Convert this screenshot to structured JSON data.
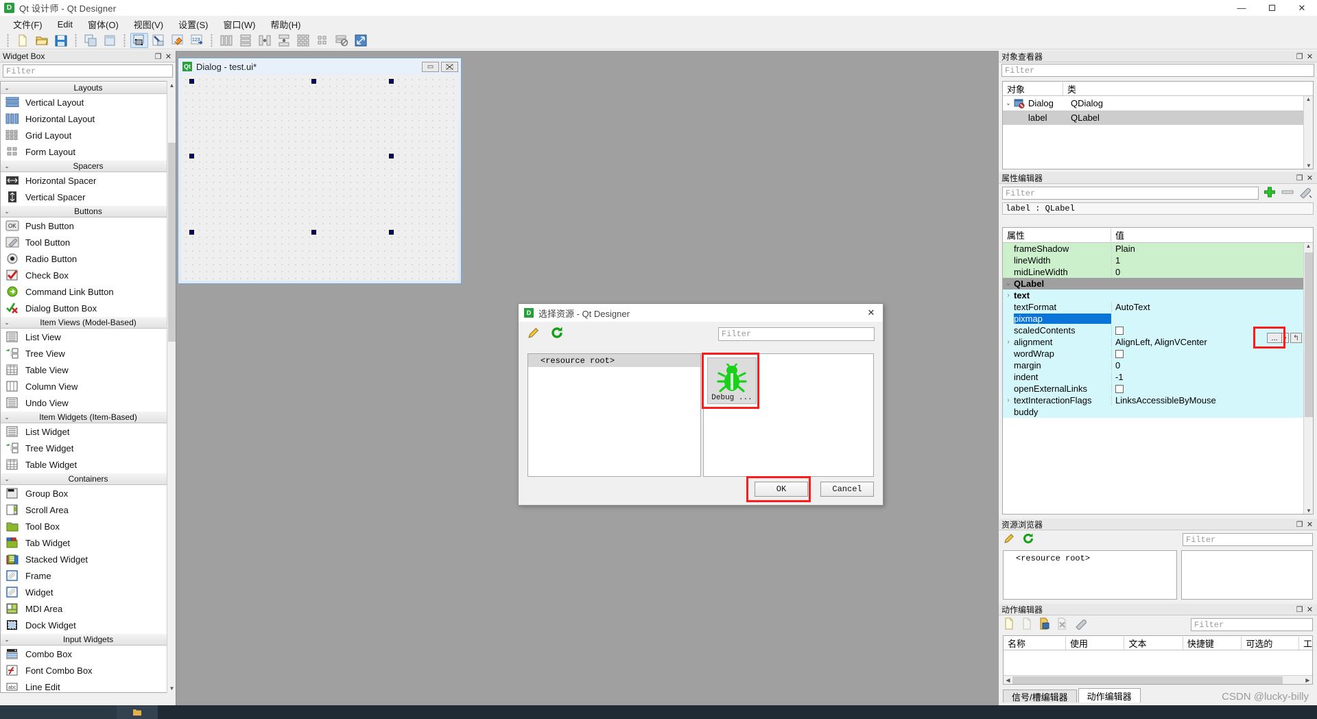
{
  "window": {
    "title": "Qt 设计师 - Qt Designer",
    "logo": "qt-logo",
    "minimize": "—",
    "maximize": "▢",
    "close": "✕"
  },
  "menubar": {
    "items": [
      {
        "label": "文件(F)"
      },
      {
        "label": "Edit"
      },
      {
        "label": "窗体(O)"
      },
      {
        "label": "视图(V)"
      },
      {
        "label": "设置(S)"
      },
      {
        "label": "窗口(W)"
      },
      {
        "label": "帮助(H)"
      }
    ]
  },
  "toolbar": {
    "groups": [
      [
        "new-file-icon",
        "open-folder-icon",
        "save-disk-icon"
      ],
      [
        "copy-windows-icon",
        "paste-window-icon"
      ],
      [
        "edit-widgets-icon",
        "edit-signals-slots-icon",
        "edit-buddies-icon",
        "edit-tab-order-icon"
      ],
      [
        "layout-horizontally-icon",
        "layout-vertically-icon",
        "layout-splitter-h-icon",
        "layout-splitter-v-icon",
        "layout-grid-icon",
        "layout-form-icon",
        "break-layout-icon",
        "adjust-size-icon"
      ]
    ]
  },
  "widget_box": {
    "title": "Widget Box",
    "undock": "❐",
    "close": "✕",
    "filter_placeholder": "Filter",
    "groups": [
      {
        "label": "Layouts",
        "items": [
          {
            "label": "Vertical Layout",
            "icon": "vertical-layout-icon"
          },
          {
            "label": "Horizontal Layout",
            "icon": "horizontal-layout-icon"
          },
          {
            "label": "Grid Layout",
            "icon": "grid-layout-icon"
          },
          {
            "label": "Form Layout",
            "icon": "form-layout-icon"
          }
        ]
      },
      {
        "label": "Spacers",
        "items": [
          {
            "label": "Horizontal Spacer",
            "icon": "horizontal-spacer-icon"
          },
          {
            "label": "Vertical Spacer",
            "icon": "vertical-spacer-icon"
          }
        ]
      },
      {
        "label": "Buttons",
        "items": [
          {
            "label": "Push Button",
            "icon": "push-button-icon"
          },
          {
            "label": "Tool Button",
            "icon": "tool-button-icon"
          },
          {
            "label": "Radio Button",
            "icon": "radio-button-icon"
          },
          {
            "label": "Check Box",
            "icon": "check-box-icon"
          },
          {
            "label": "Command Link Button",
            "icon": "command-link-button-icon"
          },
          {
            "label": "Dialog Button Box",
            "icon": "dialog-button-box-icon"
          }
        ]
      },
      {
        "label": "Item Views (Model-Based)",
        "items": [
          {
            "label": "List View",
            "icon": "list-view-icon"
          },
          {
            "label": "Tree View",
            "icon": "tree-view-icon"
          },
          {
            "label": "Table View",
            "icon": "table-view-icon"
          },
          {
            "label": "Column View",
            "icon": "column-view-icon"
          },
          {
            "label": "Undo View",
            "icon": "undo-view-icon"
          }
        ]
      },
      {
        "label": "Item Widgets (Item-Based)",
        "items": [
          {
            "label": "List Widget",
            "icon": "list-widget-icon"
          },
          {
            "label": "Tree Widget",
            "icon": "tree-widget-icon"
          },
          {
            "label": "Table Widget",
            "icon": "table-widget-icon"
          }
        ]
      },
      {
        "label": "Containers",
        "items": [
          {
            "label": "Group Box",
            "icon": "group-box-icon"
          },
          {
            "label": "Scroll Area",
            "icon": "scroll-area-icon"
          },
          {
            "label": "Tool Box",
            "icon": "tool-box-icon"
          },
          {
            "label": "Tab Widget",
            "icon": "tab-widget-icon"
          },
          {
            "label": "Stacked Widget",
            "icon": "stacked-widget-icon"
          },
          {
            "label": "Frame",
            "icon": "frame-icon"
          },
          {
            "label": "Widget",
            "icon": "widget-icon"
          },
          {
            "label": "MDI Area",
            "icon": "mdi-area-icon"
          },
          {
            "label": "Dock Widget",
            "icon": "dock-widget-icon"
          }
        ]
      },
      {
        "label": "Input Widgets",
        "items": [
          {
            "label": "Combo Box",
            "icon": "combo-box-icon"
          },
          {
            "label": "Font Combo Box",
            "icon": "font-combo-box-icon"
          },
          {
            "label": "Line Edit",
            "icon": "line-edit-icon"
          }
        ]
      }
    ]
  },
  "form_window": {
    "title": "Dialog - test.ui*",
    "minimize": "▭",
    "close": "✕"
  },
  "object_inspector": {
    "title": "对象查看器",
    "undock": "❐",
    "close": "✕",
    "filter_placeholder": "Filter",
    "columns": [
      "对象",
      "类"
    ],
    "rows": [
      {
        "name": "Dialog",
        "class": "QDialog",
        "level": 0,
        "expanded": true,
        "selected": false
      },
      {
        "name": "label",
        "class": "QLabel",
        "level": 1,
        "expanded": false,
        "selected": true
      }
    ]
  },
  "property_editor": {
    "title": "属性编辑器",
    "undock": "❐",
    "close": "✕",
    "filter_placeholder": "Filter",
    "add_button": "+",
    "remove_button": "—",
    "config_button": "wrench-icon",
    "object_header": "label : QLabel",
    "columns": [
      "属性",
      "值"
    ],
    "rows": [
      {
        "name": "frameShadow",
        "value": "Plain",
        "style": "green",
        "expandable": false
      },
      {
        "name": "lineWidth",
        "value": "1",
        "style": "green",
        "expandable": false
      },
      {
        "name": "midLineWidth",
        "value": "0",
        "style": "green",
        "expandable": false
      },
      {
        "name": "QLabel",
        "value": "",
        "style": "category",
        "expandable": true
      },
      {
        "name": "text",
        "value": "",
        "style": "cyan",
        "expandable": true,
        "bold": true
      },
      {
        "name": "textFormat",
        "value": "AutoText",
        "style": "cyan",
        "expandable": false
      },
      {
        "name": "pixmap",
        "value": "",
        "style": "selected",
        "expandable": false,
        "editing": true
      },
      {
        "name": "scaledContents",
        "value": "",
        "style": "cyan",
        "expandable": false,
        "checkbox": true
      },
      {
        "name": "alignment",
        "value": "AlignLeft, AlignVCenter",
        "style": "cyan",
        "expandable": true
      },
      {
        "name": "wordWrap",
        "value": "",
        "style": "cyan",
        "expandable": false,
        "checkbox": true
      },
      {
        "name": "margin",
        "value": "0",
        "style": "cyan",
        "expandable": false
      },
      {
        "name": "indent",
        "value": "-1",
        "style": "cyan",
        "expandable": false
      },
      {
        "name": "openExternalLinks",
        "value": "",
        "style": "cyan",
        "expandable": false,
        "checkbox": true
      },
      {
        "name": "textInteractionFlags",
        "value": "LinksAccessibleByMouse",
        "style": "cyan",
        "expandable": true
      },
      {
        "name": "buddy",
        "value": "",
        "style": "cyan",
        "expandable": false
      }
    ],
    "pixmap_browse_button": "...",
    "pixmap_dropdown_button": "▾",
    "pixmap_reset_button": "↰"
  },
  "resource_browser": {
    "title": "资源浏览器",
    "undock": "❐",
    "close": "✕",
    "edit_icon": "pencil-icon",
    "reload_icon": "reload-icon",
    "filter_placeholder": "Filter",
    "tree_items": [
      "<resource root>"
    ]
  },
  "action_editor": {
    "title": "动作编辑器",
    "undock": "❐",
    "close": "✕",
    "filter_placeholder": "Filter",
    "toolbar_icons": [
      "new-action-icon",
      "edit-action-icon",
      "copy-action-icon",
      "delete-action-icon",
      "view-mode-icon"
    ],
    "columns": [
      "名称",
      "使用",
      "文本",
      "快捷键",
      "可选的",
      "工"
    ],
    "rows": [],
    "tabs": [
      {
        "label": "信号/槽编辑器",
        "active": false
      },
      {
        "label": "动作编辑器",
        "active": true
      }
    ]
  },
  "resource_dialog": {
    "title": "选择资源 - Qt Designer",
    "logo": "qt-logo",
    "close": "✕",
    "edit_icon": "pencil-icon",
    "reload_icon": "reload-icon",
    "filter_placeholder": "Filter",
    "tree_items": [
      "<resource root>"
    ],
    "resources": [
      {
        "label": "Debug ...",
        "icon": "bug-icon"
      }
    ],
    "ok_button": "OK",
    "cancel_button": "Cancel"
  },
  "watermark": "CSDN @lucky-billy",
  "colors": {
    "accent_red": "#fd1c1c",
    "selection_blue": "#0a74d8",
    "green_prop": "#ccf0cc",
    "cyan_prop": "#d4f7fb",
    "canvas_gray": "#a0a0a0"
  }
}
